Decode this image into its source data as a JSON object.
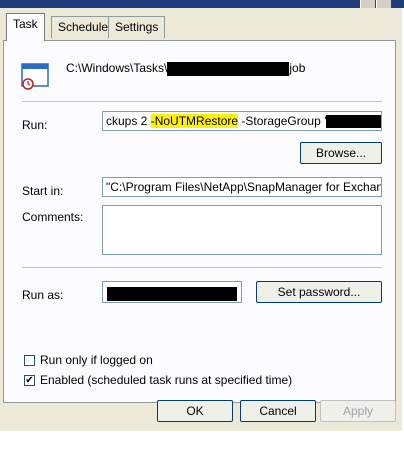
{
  "tabs": [
    {
      "label": "Task"
    },
    {
      "label": "Schedule"
    },
    {
      "label": "Settings"
    }
  ],
  "task": {
    "path_prefix": "C:\\Windows\\Tasks\\",
    "path_suffix": "job"
  },
  "run": {
    "label": "Run:",
    "value_pre": "ckups 2 ",
    "value_highlight": "-NoUTMRestore",
    "value_post": " -StorageGroup '",
    "highlight_color": "#fff200"
  },
  "browse_label": "Browse...",
  "start_in": {
    "label": "Start in:",
    "value": "\"C:\\Program Files\\NetApp\\SnapManager for Exchange\\\""
  },
  "comments": {
    "label": "Comments:",
    "value": ""
  },
  "run_as": {
    "label": "Run as:"
  },
  "set_password_label": "Set password...",
  "checkboxes": [
    {
      "label": "Run only if logged on",
      "checked": false
    },
    {
      "label": "Enabled (scheduled task runs at specified time)",
      "checked": true
    }
  ],
  "buttons": {
    "ok": "OK",
    "cancel": "Cancel",
    "apply": "Apply"
  }
}
